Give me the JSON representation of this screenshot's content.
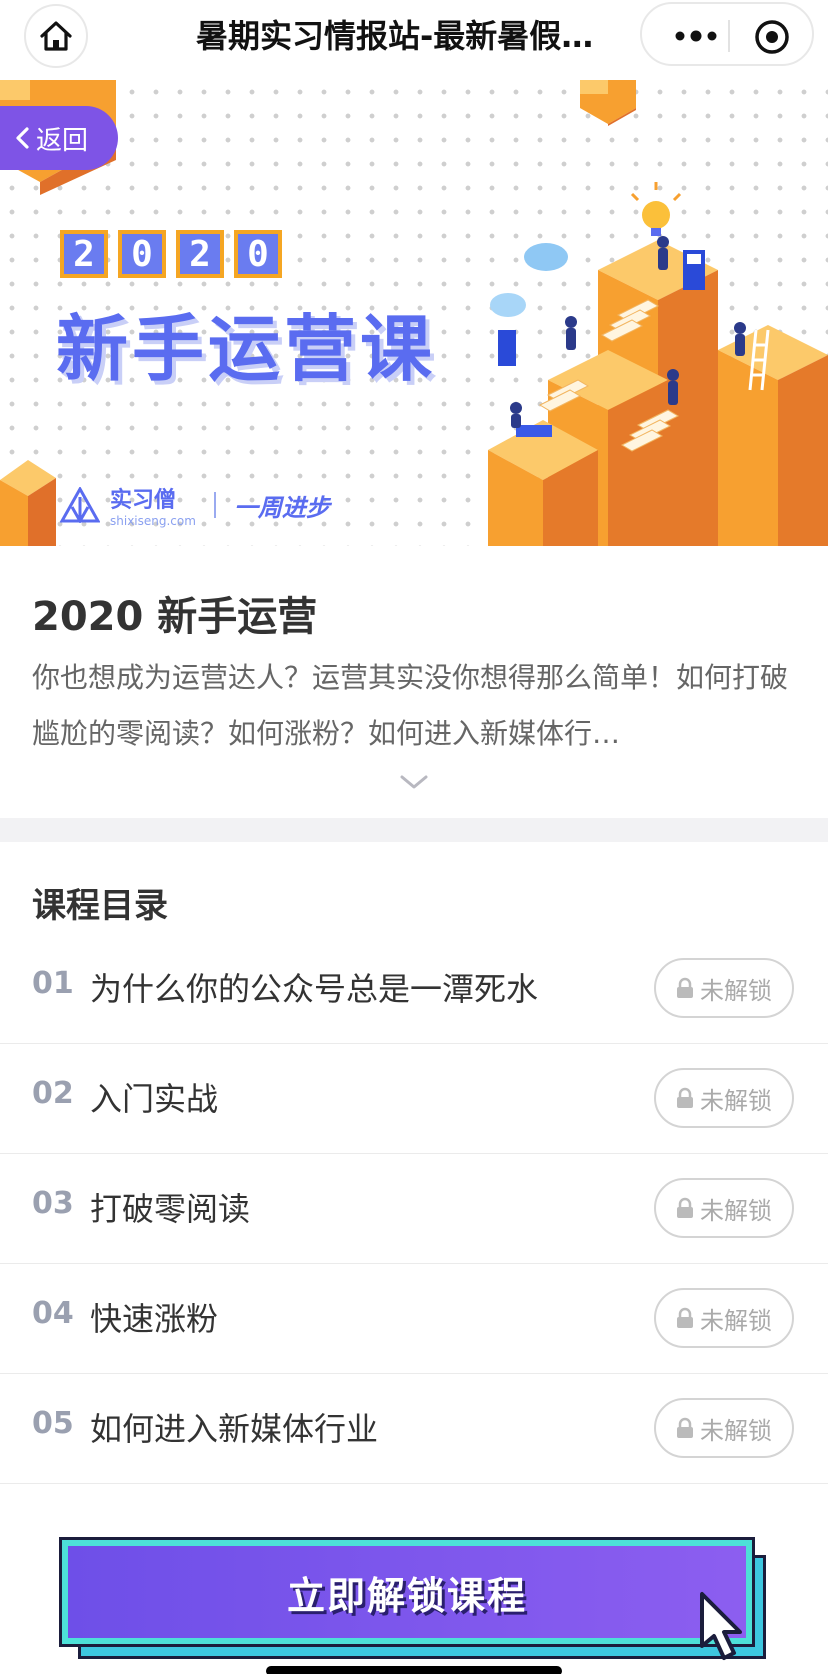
{
  "nav": {
    "title": "暑期实习情报站-最新暑假…"
  },
  "banner": {
    "back_label": "返回",
    "year_digits": [
      "2",
      "0",
      "2",
      "0"
    ],
    "headline": "新手运营课",
    "brand_name": "实习僧",
    "brand_sub": "shixiseng.com",
    "slogan": "一周进步"
  },
  "intro": {
    "title": "2020 新手运营",
    "description": "你也想成为运营达人？运营其实没你想得那么简单！如何打破尴尬的零阅读？如何涨粉？如何进入新媒体行…"
  },
  "catalog": {
    "title": "课程目录",
    "lock_label": "未解锁",
    "items": [
      {
        "num": "01",
        "name": "为什么你的公众号总是一潭死水",
        "status": "未解锁"
      },
      {
        "num": "02",
        "name": "入门实战",
        "status": "未解锁"
      },
      {
        "num": "03",
        "name": "打破零阅读",
        "status": "未解锁"
      },
      {
        "num": "04",
        "name": "快速涨粉",
        "status": "未解锁"
      },
      {
        "num": "05",
        "name": "如何进入新媒体行业",
        "status": "未解锁"
      }
    ]
  },
  "cta": {
    "label": "立即解锁课程"
  },
  "colors": {
    "accent_purple": "#7e54e6",
    "headline_blue": "#5a6cf0",
    "orange": "#f7a030",
    "cta_cyan": "#4de0d8"
  }
}
